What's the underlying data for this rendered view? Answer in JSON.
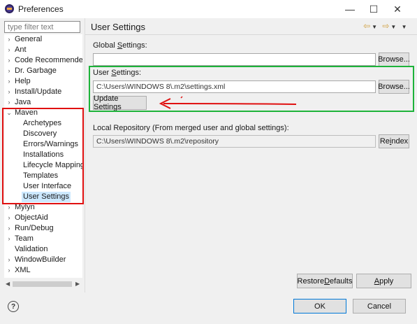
{
  "window": {
    "title": "Preferences",
    "minimize": "—",
    "maximize": "☐",
    "close": "✕"
  },
  "filter": {
    "placeholder": "type filter text",
    "value": ""
  },
  "tree": [
    {
      "label": "General",
      "expandable": true,
      "expanded": false,
      "child": false
    },
    {
      "label": "Ant",
      "expandable": true,
      "expanded": false,
      "child": false
    },
    {
      "label": "Code Recommenders",
      "expandable": true,
      "expanded": false,
      "child": false
    },
    {
      "label": "Dr. Garbage",
      "expandable": true,
      "expanded": false,
      "child": false
    },
    {
      "label": "Help",
      "expandable": true,
      "expanded": false,
      "child": false
    },
    {
      "label": "Install/Update",
      "expandable": true,
      "expanded": false,
      "child": false
    },
    {
      "label": "Java",
      "expandable": true,
      "expanded": false,
      "child": false
    },
    {
      "label": "Maven",
      "expandable": true,
      "expanded": true,
      "child": false
    },
    {
      "label": "Archetypes",
      "expandable": false,
      "child": true
    },
    {
      "label": "Discovery",
      "expandable": false,
      "child": true
    },
    {
      "label": "Errors/Warnings",
      "expandable": false,
      "child": true
    },
    {
      "label": "Installations",
      "expandable": false,
      "child": true
    },
    {
      "label": "Lifecycle Mappings",
      "expandable": false,
      "child": true
    },
    {
      "label": "Templates",
      "expandable": false,
      "child": true
    },
    {
      "label": "User Interface",
      "expandable": false,
      "child": true
    },
    {
      "label": "User Settings",
      "expandable": false,
      "child": true,
      "selected": true
    },
    {
      "label": "Mylyn",
      "expandable": true,
      "expanded": false,
      "child": false
    },
    {
      "label": "ObjectAid",
      "expandable": true,
      "expanded": false,
      "child": false
    },
    {
      "label": "Run/Debug",
      "expandable": true,
      "expanded": false,
      "child": false
    },
    {
      "label": "Team",
      "expandable": true,
      "expanded": false,
      "child": false
    },
    {
      "label": "Validation",
      "expandable": false,
      "child": false
    },
    {
      "label": "WindowBuilder",
      "expandable": true,
      "expanded": false,
      "child": false
    },
    {
      "label": "XML",
      "expandable": true,
      "expanded": false,
      "child": false
    }
  ],
  "page": {
    "title": "User Settings",
    "global_settings": {
      "label_pre": "Global ",
      "label_mnemonic": "S",
      "label_post": "ettings:",
      "value": "",
      "browse": "Browse..."
    },
    "user_settings": {
      "label_pre": "User ",
      "label_mnemonic": "S",
      "label_post": "ettings:",
      "value": "C:\\Users\\WINDOWS 8\\.m2\\settings.xml",
      "browse": "Browse...",
      "update": "Update Settings"
    },
    "local_repository": {
      "label": "Local Repository (From merged user and global settings):",
      "value": "C:\\Users\\WINDOWS 8\\.m2\\repository",
      "reindex_pre": "Re",
      "reindex_mnemonic": "i",
      "reindex_post": "ndex"
    },
    "restore_defaults_pre": "Restore ",
    "restore_defaults_mnemonic": "D",
    "restore_defaults_post": "efaults",
    "apply_pre": "",
    "apply_mnemonic": "A",
    "apply_post": "pply"
  },
  "footer": {
    "help": "?",
    "ok": "OK",
    "cancel": "Cancel"
  },
  "colors": {
    "green_highlight": "#1db33a",
    "red_highlight": "#e01010",
    "arrow": "#e01010",
    "selection": "#cce8ff"
  }
}
